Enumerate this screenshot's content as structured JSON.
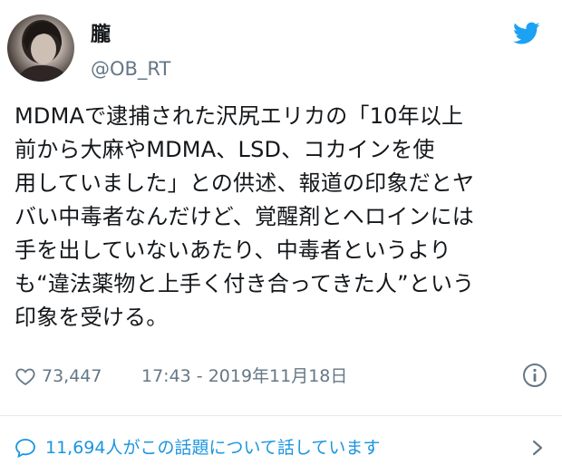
{
  "user": {
    "display_name": "朧",
    "handle": "@OB_RT"
  },
  "tweet": {
    "text": "MDMAで逮捕された沢尻エリカの「10年以上\n前から大麻やMDMA、LSD、コカインを使\n用していました」との供述、報道の印象だとヤ\nバい中毒者なんだけど、覚醒剤とヘロインには\n手を出していないあたり、中毒者というより\nも“違法薬物と上手く付き合ってきた人”という\n印象を受ける。"
  },
  "meta": {
    "likes": "73,447",
    "timestamp": "17:43 - 2019年11月18日"
  },
  "footer": {
    "conversation": "11,694人がこの話題について話しています"
  },
  "colors": {
    "accent": "#1b95e0",
    "muted": "#657786",
    "text": "#14171a"
  },
  "icons": {
    "brand": "twitter-bird-icon",
    "like": "heart-icon",
    "info": "info-icon",
    "reply": "speech-bubble-icon",
    "next": "chevron-right-icon"
  }
}
